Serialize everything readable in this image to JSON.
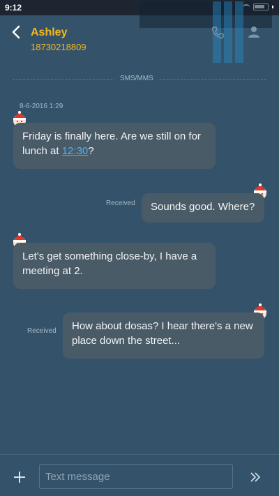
{
  "status_bar": {
    "time": "9:12"
  },
  "header": {
    "name": "Ashley",
    "number": "18730218809"
  },
  "thread": {
    "channel_label": "SMS/MMS",
    "date": "8-6-2016 1:29",
    "messages": [
      {
        "direction": "incoming",
        "text_before": "Friday is finally here. Are we still on for lunch at ",
        "link": "12:30",
        "text_after": "?"
      },
      {
        "direction": "outgoing",
        "status": "Received",
        "text": "Sounds good. Where?"
      },
      {
        "direction": "incoming",
        "text": "Let's get something close-by, I have a meeting at 2."
      },
      {
        "direction": "outgoing",
        "status": "Received",
        "text": "How about dosas? I hear there's a new place down the street..."
      }
    ]
  },
  "composer": {
    "placeholder": "Text message"
  },
  "icons": {
    "back": "back-arrow-icon",
    "call": "phone-icon",
    "contact": "person-icon",
    "attach": "plus-icon",
    "send": "send-icon",
    "avatar": "santa-avatar-icon"
  },
  "colors": {
    "background": "#34536b",
    "accent": "#f4b81c",
    "bubble": "#4a5b68",
    "link": "#4fb0ef"
  }
}
